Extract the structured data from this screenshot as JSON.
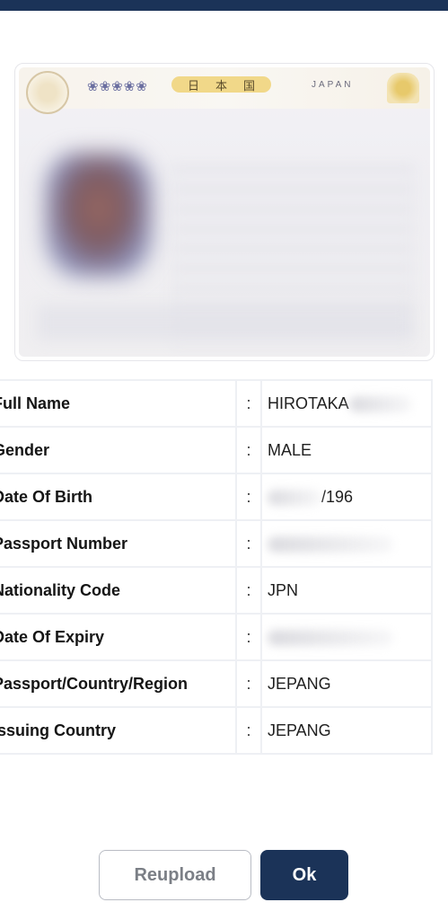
{
  "passport_image": {
    "kanji": [
      "日",
      "本",
      "国"
    ],
    "country_text": "JAPAN"
  },
  "details": [
    {
      "label": "Full Name",
      "colon": ":",
      "value": "HIROTAKA",
      "redacted": true
    },
    {
      "label": "Gender",
      "colon": ":",
      "value": "MALE",
      "redacted": false
    },
    {
      "label": "Date Of Birth",
      "colon": ":",
      "value": "/196",
      "redacted": true
    },
    {
      "label": "Passport Number",
      "colon": ":",
      "value": "",
      "redacted": true
    },
    {
      "label": "Nationality Code",
      "colon": ":",
      "value": "JPN",
      "redacted": false
    },
    {
      "label": "Date Of Expiry",
      "colon": ":",
      "value": "",
      "redacted": true
    },
    {
      "label": "Passport/Country/Region",
      "colon": ":",
      "value": "JEPANG",
      "redacted": false
    },
    {
      "label": "Issuing Country",
      "colon": ":",
      "value": "JEPANG",
      "redacted": false
    }
  ],
  "actions": {
    "reupload_label": "Reupload",
    "ok_label": "Ok"
  },
  "colors": {
    "primary": "#1b3358",
    "border": "#eef0f4"
  }
}
